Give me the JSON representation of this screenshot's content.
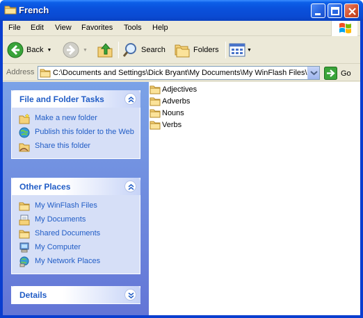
{
  "window": {
    "title": "French"
  },
  "menubar": {
    "items": [
      "File",
      "Edit",
      "View",
      "Favorites",
      "Tools",
      "Help"
    ]
  },
  "toolbar": {
    "back_label": "Back",
    "search_label": "Search",
    "folders_label": "Folders"
  },
  "addressbar": {
    "label": "Address",
    "value": "C:\\Documents and Settings\\Dick Bryant\\My Documents\\My WinFlash Files\\French",
    "go_label": "Go"
  },
  "taskpane": {
    "file_tasks": {
      "title": "File and Folder Tasks",
      "items": [
        "Make a new folder",
        "Publish this folder to the Web",
        "Share this folder"
      ]
    },
    "other_places": {
      "title": "Other Places",
      "items": [
        "My WinFlash Files",
        "My Documents",
        "Shared Documents",
        "My Computer",
        "My Network Places"
      ]
    },
    "details": {
      "title": "Details"
    }
  },
  "files": [
    "Adjectives",
    "Adverbs",
    "Nouns",
    "Verbs"
  ],
  "colors": {
    "titlebar": "#0a51dc",
    "taskpane_link": "#215dc6",
    "panel_bg": "#d6dff7",
    "chrome": "#ece9d8"
  }
}
